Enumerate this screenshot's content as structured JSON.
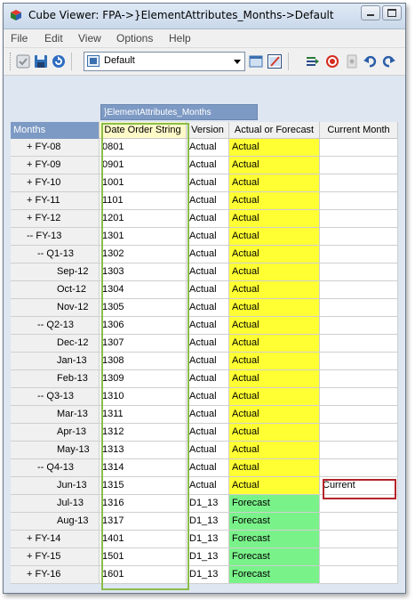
{
  "window": {
    "title": "Cube Viewer: FPA->}ElementAttributes_Months->Default"
  },
  "menu": [
    "File",
    "Edit",
    "View",
    "Options",
    "Help"
  ],
  "toolbar": {
    "view_name": "Default"
  },
  "cube_label": "}ElementAttributes_Months",
  "headers": {
    "row_dim": "Months",
    "columns": [
      "Date Order String",
      "Version",
      "Actual or Forecast",
      "Current Month"
    ]
  },
  "colors": {
    "actual": "#ffff33",
    "forecast": "#7af28a",
    "highlight_frame": "#8bbd4a",
    "current_frame": "#b4232a",
    "header_blue": "#7d9ac4"
  },
  "rows": [
    {
      "label": "+ FY-08",
      "indent": 1,
      "date": "0801",
      "version": "Actual",
      "aof": "Actual",
      "current": ""
    },
    {
      "label": "+ FY-09",
      "indent": 1,
      "date": "0901",
      "version": "Actual",
      "aof": "Actual",
      "current": ""
    },
    {
      "label": "+ FY-10",
      "indent": 1,
      "date": "1001",
      "version": "Actual",
      "aof": "Actual",
      "current": ""
    },
    {
      "label": "+ FY-11",
      "indent": 1,
      "date": "1101",
      "version": "Actual",
      "aof": "Actual",
      "current": ""
    },
    {
      "label": "+ FY-12",
      "indent": 1,
      "date": "1201",
      "version": "Actual",
      "aof": "Actual",
      "current": ""
    },
    {
      "label": "-- FY-13",
      "indent": 1,
      "date": "1301",
      "version": "Actual",
      "aof": "Actual",
      "current": ""
    },
    {
      "label": "-- Q1-13",
      "indent": 2,
      "date": "1302",
      "version": "Actual",
      "aof": "Actual",
      "current": ""
    },
    {
      "label": "Sep-12",
      "indent": 3,
      "date": "1303",
      "version": "Actual",
      "aof": "Actual",
      "current": ""
    },
    {
      "label": "Oct-12",
      "indent": 3,
      "date": "1304",
      "version": "Actual",
      "aof": "Actual",
      "current": ""
    },
    {
      "label": "Nov-12",
      "indent": 3,
      "date": "1305",
      "version": "Actual",
      "aof": "Actual",
      "current": ""
    },
    {
      "label": "-- Q2-13",
      "indent": 2,
      "date": "1306",
      "version": "Actual",
      "aof": "Actual",
      "current": ""
    },
    {
      "label": "Dec-12",
      "indent": 3,
      "date": "1307",
      "version": "Actual",
      "aof": "Actual",
      "current": ""
    },
    {
      "label": "Jan-13",
      "indent": 3,
      "date": "1308",
      "version": "Actual",
      "aof": "Actual",
      "current": ""
    },
    {
      "label": "Feb-13",
      "indent": 3,
      "date": "1309",
      "version": "Actual",
      "aof": "Actual",
      "current": ""
    },
    {
      "label": "-- Q3-13",
      "indent": 2,
      "date": "1310",
      "version": "Actual",
      "aof": "Actual",
      "current": ""
    },
    {
      "label": "Mar-13",
      "indent": 3,
      "date": "1311",
      "version": "Actual",
      "aof": "Actual",
      "current": ""
    },
    {
      "label": "Apr-13",
      "indent": 3,
      "date": "1312",
      "version": "Actual",
      "aof": "Actual",
      "current": ""
    },
    {
      "label": "May-13",
      "indent": 3,
      "date": "1313",
      "version": "Actual",
      "aof": "Actual",
      "current": ""
    },
    {
      "label": "-- Q4-13",
      "indent": 2,
      "date": "1314",
      "version": "Actual",
      "aof": "Actual",
      "current": ""
    },
    {
      "label": "Jun-13",
      "indent": 3,
      "date": "1315",
      "version": "Actual",
      "aof": "Actual",
      "current": "Current"
    },
    {
      "label": "Jul-13",
      "indent": 3,
      "date": "1316",
      "version": "D1_13",
      "aof": "Forecast",
      "current": ""
    },
    {
      "label": "Aug-13",
      "indent": 3,
      "date": "1317",
      "version": "D1_13",
      "aof": "Forecast",
      "current": ""
    },
    {
      "label": "+ FY-14",
      "indent": 1,
      "date": "1401",
      "version": "D1_13",
      "aof": "Forecast",
      "current": ""
    },
    {
      "label": "+ FY-15",
      "indent": 1,
      "date": "1501",
      "version": "D1_13",
      "aof": "Forecast",
      "current": ""
    },
    {
      "label": "+ FY-16",
      "indent": 1,
      "date": "1601",
      "version": "D1_13",
      "aof": "Forecast",
      "current": ""
    }
  ]
}
